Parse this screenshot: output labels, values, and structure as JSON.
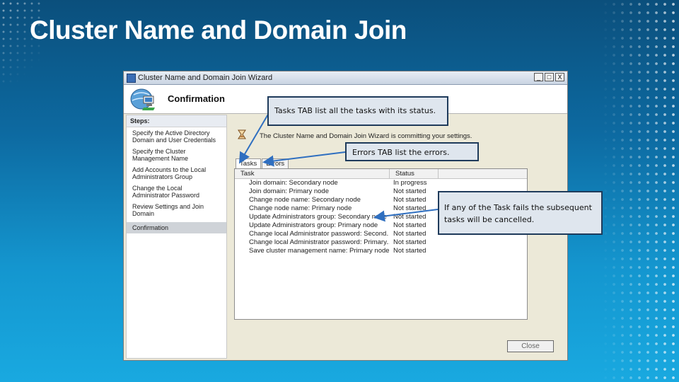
{
  "slide": {
    "title": "Cluster Name and Domain Join"
  },
  "window": {
    "title": "Cluster Name and Domain Join Wizard",
    "minimize": "_",
    "maximize": "□",
    "close": "X",
    "header_title": "Confirmation",
    "status_text": "The Cluster Name and Domain Join Wizard is committing your settings.",
    "close_button": "Close"
  },
  "steps": {
    "heading": "Steps:",
    "items": [
      "Specify the Active Directory Domain and User Credentials",
      "Specify the Cluster Management Name",
      "Add Accounts to the Local Administrators Group",
      "Change the Local Administrator Password",
      "Review Settings and Join Domain",
      "Confirmation"
    ]
  },
  "tabs": [
    "Tasks",
    "Errors"
  ],
  "columns": [
    "Task",
    "Status"
  ],
  "tasks": [
    {
      "task": "Join domain: Secondary node",
      "status": "In progress"
    },
    {
      "task": "Join domain: Primary node",
      "status": "Not started"
    },
    {
      "task": "Change node name: Secondary node",
      "status": "Not started"
    },
    {
      "task": "Change node name: Primary node",
      "status": "Not started"
    },
    {
      "task": "Update Administrators group: Secondary node",
      "status": "Not started"
    },
    {
      "task": "Update Administrators group: Primary node",
      "status": "Not started"
    },
    {
      "task": "Change local Administrator password: Second...",
      "status": "Not started"
    },
    {
      "task": "Change local Administrator password: Primary...",
      "status": "Not started"
    },
    {
      "task": "Save cluster management name: Primary node",
      "status": "Not started"
    }
  ],
  "callouts": {
    "tasks": "Tasks TAB list all the tasks with its status.",
    "errors": "Errors TAB list the errors.",
    "failure": "If any of the Task fails the subsequent tasks will be cancelled."
  },
  "colors": {
    "background_top": "#0b4f7c",
    "background_bottom": "#19a9e0",
    "callout_border": "#1f3b5b",
    "callout_fill": "#dfe6ee",
    "arrow": "#2f6fc0"
  }
}
